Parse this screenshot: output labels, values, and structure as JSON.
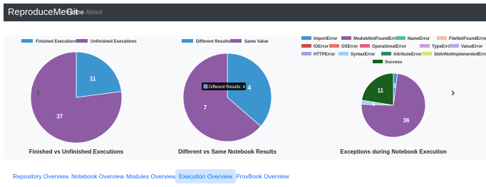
{
  "navbar": {
    "brand": "ReproduceMeGit",
    "links": [
      "Home",
      "About"
    ]
  },
  "colors": {
    "blue": "#3d95d0",
    "purple": "#8e5ba5",
    "green": "#1a5e20"
  },
  "chart_data": [
    {
      "type": "pie",
      "title": "Finished vs Unfinished Executions",
      "legend": [
        "Finished Executions",
        "Unfinished Executions"
      ],
      "values": [
        11,
        37
      ],
      "value_labels": [
        "11",
        "37"
      ],
      "colors": [
        "#3d95d0",
        "#8e5ba5"
      ]
    },
    {
      "type": "pie",
      "title": "Different vs Same Notebook Results",
      "legend": [
        "Different Results",
        "Same Value"
      ],
      "values": [
        4,
        7
      ],
      "value_labels": [
        "4",
        "7"
      ],
      "colors": [
        "#3d95d0",
        "#8e5ba5"
      ],
      "tooltip": "Different Results: 4"
    },
    {
      "type": "pie",
      "title": "Exceptions during Notebook Execution",
      "legend": [
        "ImportError",
        "ModuleNotFoundError",
        "NameError",
        "FileNotFoundError",
        "IOError",
        "OSError",
        "OperationalError",
        "TypeError",
        "ValueError",
        "HTTPError",
        "SyntaxError",
        "AttributeError",
        "StdinNotImplementedError",
        "Success"
      ],
      "legend_colors": [
        "#3d95d0",
        "#8e5ba5",
        "#4cbf9f",
        "#f0c0ab",
        "#c94c4c",
        "#e8736c",
        "#e85e7a",
        "#c8a0d8",
        "#b7a7e0",
        "#a0a8d8",
        "#9fd0ea",
        "#2e8b57",
        "#d6e67a",
        "#1a5e20"
      ],
      "values": [
        1,
        36,
        1,
        11
      ],
      "value_labels": [
        "1",
        "36",
        "1",
        "11"
      ],
      "slice_colors": [
        "#3d95d0",
        "#8e5ba5",
        "#9fd0ea",
        "#1a5e20"
      ]
    }
  ],
  "tabs": [
    "Repository Overview",
    "Notebook Overview",
    "Modules Overview",
    "Execution Overview",
    "ProvBook Overview"
  ],
  "active_tab": "Execution Overview"
}
